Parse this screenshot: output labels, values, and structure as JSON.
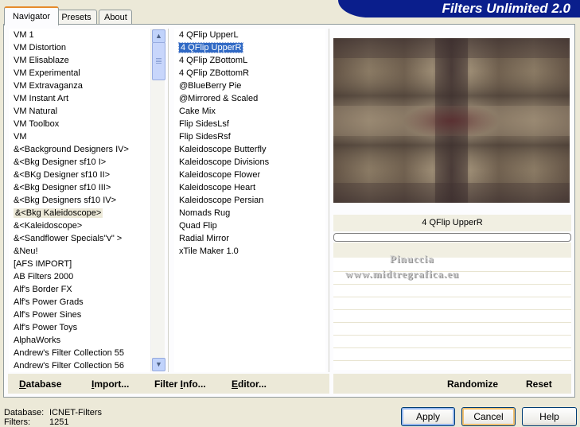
{
  "header": {
    "title": "Filters Unlimited 2.0"
  },
  "tabs": [
    {
      "label": "Navigator",
      "active": true
    },
    {
      "label": "Presets",
      "active": false
    },
    {
      "label": "About",
      "active": false
    }
  ],
  "categories": {
    "selected_index": 14,
    "items": [
      "VM 1",
      "VM Distortion",
      "VM Elisablaze",
      "VM Experimental",
      "VM Extravaganza",
      "VM Instant Art",
      "VM Natural",
      "VM Toolbox",
      "VM",
      "&<Background Designers IV>",
      "&<Bkg Designer sf10 I>",
      "&<BKg Designer sf10 II>",
      "&<Bkg Designer sf10 III>",
      "&<Bkg Designers sf10 IV>",
      "&<Bkg Kaleidoscope>",
      "&<Kaleidoscope>",
      "&<Sandflower Specials\"v\" >",
      "&Neu!",
      "[AFS IMPORT]",
      "AB Filters 2000",
      "Alf's Border FX",
      "Alf's Power Grads",
      "Alf's Power Sines",
      "Alf's Power Toys",
      "AlphaWorks",
      "Andrew's Filter Collection 55",
      "Andrew's Filter Collection 56"
    ]
  },
  "filters": {
    "selected_index": 1,
    "items": [
      "4 QFlip UpperL",
      "4 QFlip UpperR",
      "4 QFlip ZBottomL",
      "4 QFlip ZBottomR",
      "@BlueBerry Pie",
      "@Mirrored & Scaled",
      "Cake Mix",
      "Flip SidesLsf",
      "Flip SidesRsf",
      "Kaleidoscope Butterfly",
      "Kaleidoscope Divisions",
      "Kaleidoscope Flower",
      "Kaleidoscope Heart",
      "Kaleidoscope Persian",
      "Nomads Rug",
      "Quad Flip",
      "Radial Mirror",
      "xTile Maker 1.0"
    ]
  },
  "preview": {
    "filter_name": "4 QFlip UpperR"
  },
  "watermark": {
    "line1": "Pinuccia",
    "line2": "www.midtregrafica.eu"
  },
  "toolbar": {
    "database": {
      "pre": "",
      "ul": "D",
      "post": "atabase"
    },
    "import": {
      "pre": "",
      "ul": "I",
      "post": "mport..."
    },
    "filter_info": {
      "pre": "Filter ",
      "ul": "I",
      "post": "nfo..."
    },
    "editor": {
      "pre": "",
      "ul": "E",
      "post": "ditor..."
    },
    "randomize": "Randomize",
    "reset": "Reset"
  },
  "status": {
    "database_label": "Database:",
    "database_value": "ICNET-Filters",
    "filters_label": "Filters:",
    "filters_value": "1251"
  },
  "buttons": {
    "apply": "Apply",
    "cancel": "Cancel",
    "help": "Help"
  },
  "icons": {
    "scroll_up": "chevron-up-icon",
    "scroll_down": "chevron-down-icon"
  },
  "colors": {
    "banner": "#0A1E8C",
    "selection": "#316AC5",
    "focus_ring": "#F2C170"
  }
}
